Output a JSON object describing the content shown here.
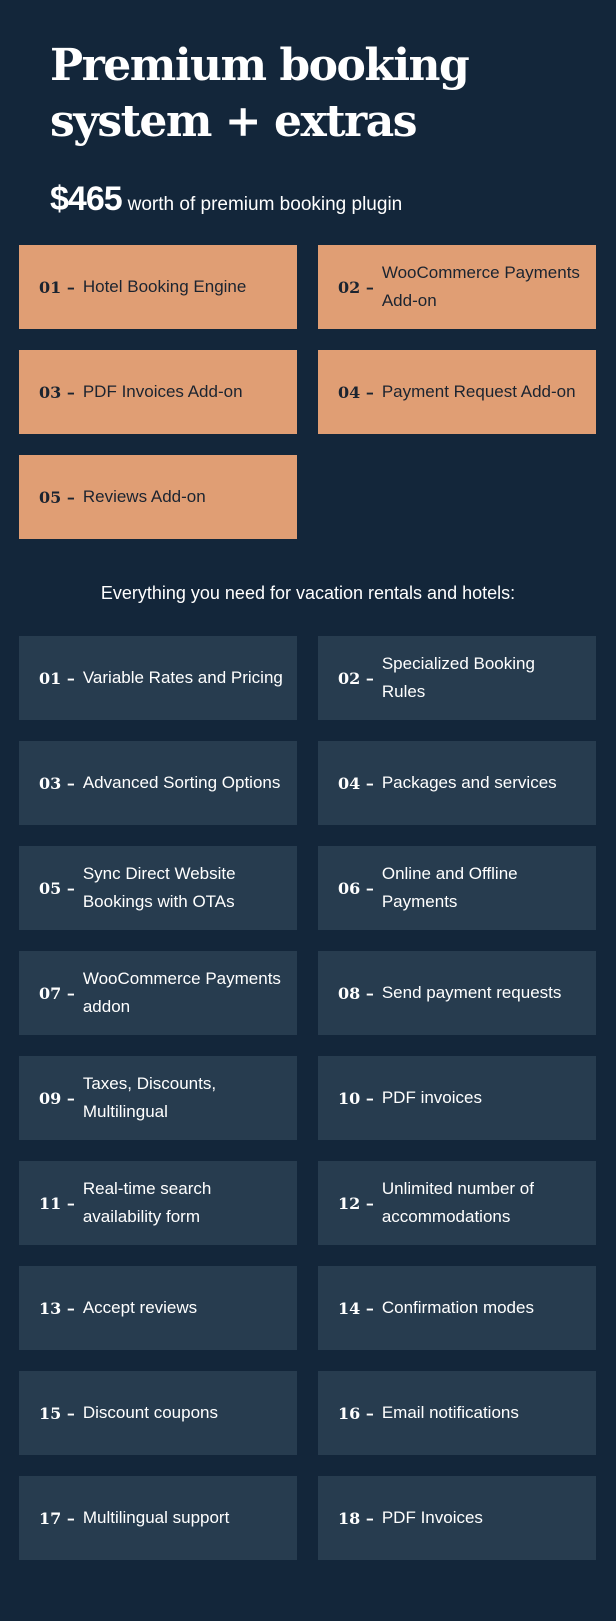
{
  "header": {
    "title_line1": "Premium booking",
    "title_line2": "system + extras",
    "price": "$465",
    "price_note": "worth of premium booking plugin"
  },
  "addons": [
    {
      "num": "01 –",
      "label": "Hotel Booking Engine"
    },
    {
      "num": "02 –",
      "label": "WooCommerce Payments Add-on"
    },
    {
      "num": "03 –",
      "label": "PDF Invoices Add-on"
    },
    {
      "num": "04 –",
      "label": "Payment Request Add-on"
    },
    {
      "num": "05 –",
      "label": "Reviews Add-on"
    }
  ],
  "features_heading": "Everything you need for vacation rentals and hotels:",
  "features": [
    {
      "num": "01 –",
      "label": "Variable Rates and Pricing"
    },
    {
      "num": "02 –",
      "label": "Specialized Booking Rules"
    },
    {
      "num": "03 –",
      "label": "Advanced Sorting Options"
    },
    {
      "num": "04 –",
      "label": "Packages and services"
    },
    {
      "num": "05 –",
      "label": "Sync Direct Website Bookings with OTAs"
    },
    {
      "num": "06 –",
      "label": "Online and Offline Payments"
    },
    {
      "num": "07 –",
      "label": "WooCommerce Payments addon"
    },
    {
      "num": "08 –",
      "label": "Send payment requests"
    },
    {
      "num": "09 –",
      "label": "Taxes, Discounts, Multilingual"
    },
    {
      "num": "10 –",
      "label": "PDF invoices"
    },
    {
      "num": "11 –",
      "label": "Real-time search availability form"
    },
    {
      "num": "12 –",
      "label": "Unlimited number of accommodations"
    },
    {
      "num": "13 –",
      "label": "Accept reviews"
    },
    {
      "num": "14 –",
      "label": "Confirmation modes"
    },
    {
      "num": "15 –",
      "label": "Discount coupons"
    },
    {
      "num": "16 –",
      "label": "Email notifications"
    },
    {
      "num": "17 –",
      "label": "Multilingual support"
    },
    {
      "num": "18 –",
      "label": "PDF Invoices"
    }
  ],
  "colors": {
    "background": "#13263a",
    "addon_box": "#e09e74",
    "feature_box": "#273c4f",
    "text_light": "#ffffff",
    "text_dark": "#1b2430"
  }
}
